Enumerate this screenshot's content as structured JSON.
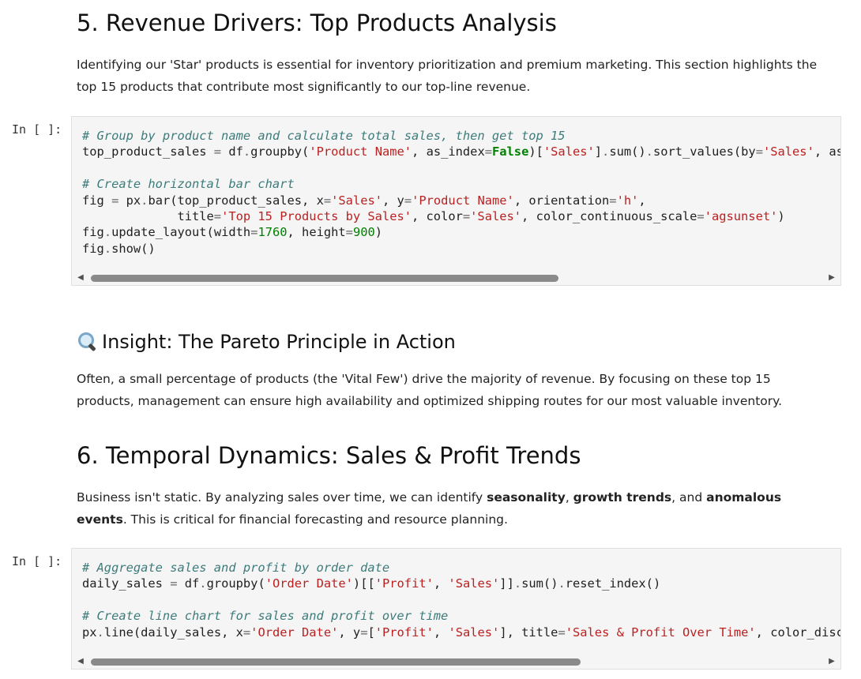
{
  "section5": {
    "title": "5. Revenue Drivers: Top Products Analysis",
    "paragraph": "Identifying our 'Star' products is essential for inventory prioritization and premium marketing. This section highlights the top 15 products that contribute most significantly to our top-line revenue."
  },
  "cell1": {
    "prompt": "In [ ]:",
    "comment1": "# Group by product name and calculate total sales, then get top 15",
    "comment2": "# Create horizontal bar chart",
    "scroll_fraction": 0.64
  },
  "insight": {
    "icon": "magnifying-glass-icon",
    "title": "Insight: The Pareto Principle in Action",
    "paragraph": "Often, a small percentage of products (the 'Vital Few') drive the majority of revenue. By focusing on these top 15 products, management can ensure high availability and optimized shipping routes for our most valuable inventory."
  },
  "section6": {
    "title": "6. Temporal Dynamics: Sales & Profit Trends",
    "paragraph_start": "Business isn't static. By analyzing sales over time, we can identify ",
    "bold1": "seasonality",
    "sep1": ", ",
    "bold2": "growth trends",
    "sep2": ", and ",
    "bold3": "anomalous events",
    "paragraph_end": ". This is critical for financial forecasting and resource planning."
  },
  "cell2": {
    "prompt": "In [ ]:",
    "comment1": "# Aggregate sales and profit by order date",
    "comment2": "# Create line chart for sales and profit over time",
    "scroll_fraction": 0.67
  }
}
